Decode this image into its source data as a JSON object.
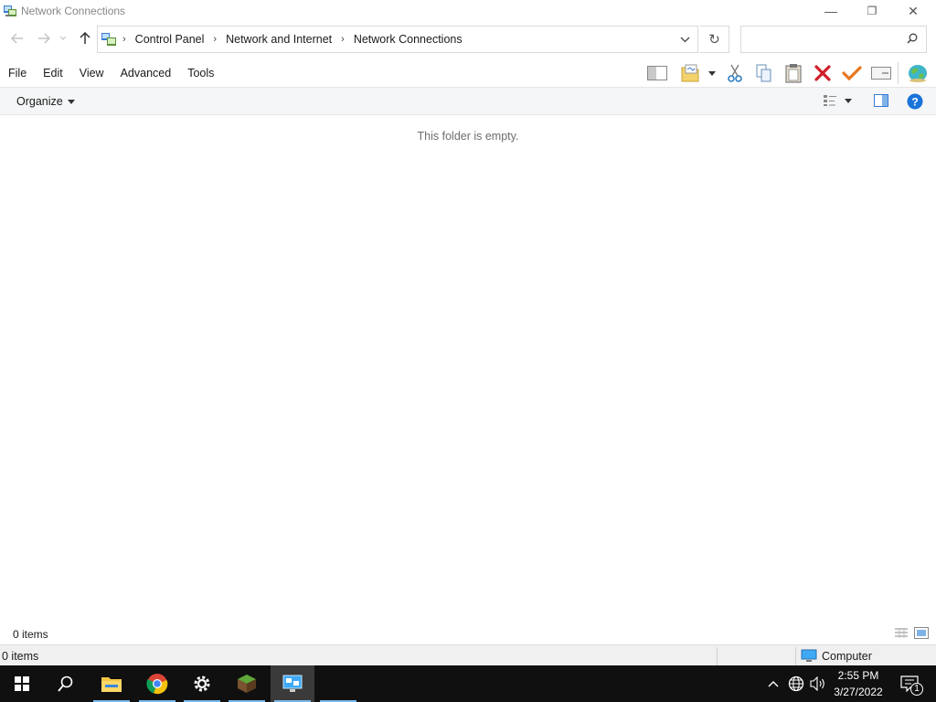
{
  "window": {
    "title": "Network Connections",
    "minimize_glyph": "—",
    "restore_glyph": "❐",
    "close_glyph": "✕"
  },
  "address": {
    "crumbs": [
      "Control Panel",
      "Network and Internet",
      "Network Connections"
    ],
    "separator": "›",
    "refresh_glyph": "↻",
    "search_placeholder": ""
  },
  "menu": {
    "items": [
      "File",
      "Edit",
      "View",
      "Advanced",
      "Tools"
    ]
  },
  "commandbar": {
    "organize_label": "Organize"
  },
  "content": {
    "empty_message": "This folder is empty."
  },
  "status": {
    "inner_count": "0 items",
    "bar_count": "0 items",
    "zone_label": "Computer"
  },
  "taskbar": {
    "time": "2:55 PM",
    "date": "3/27/2022",
    "notification_count": "1"
  },
  "icons": {
    "app": "network-connections-icon",
    "back": "back-arrow-icon",
    "forward": "forward-arrow-icon",
    "recent": "recent-locations-icon",
    "up": "up-arrow-icon",
    "search": "search-icon",
    "help": "help-icon"
  },
  "colors": {
    "accent": "#1a73d9",
    "delete_red": "#d0202a",
    "check_orange": "#e8771e",
    "taskbar_bg": "#101010",
    "active_indicator": "#76b9ed"
  }
}
